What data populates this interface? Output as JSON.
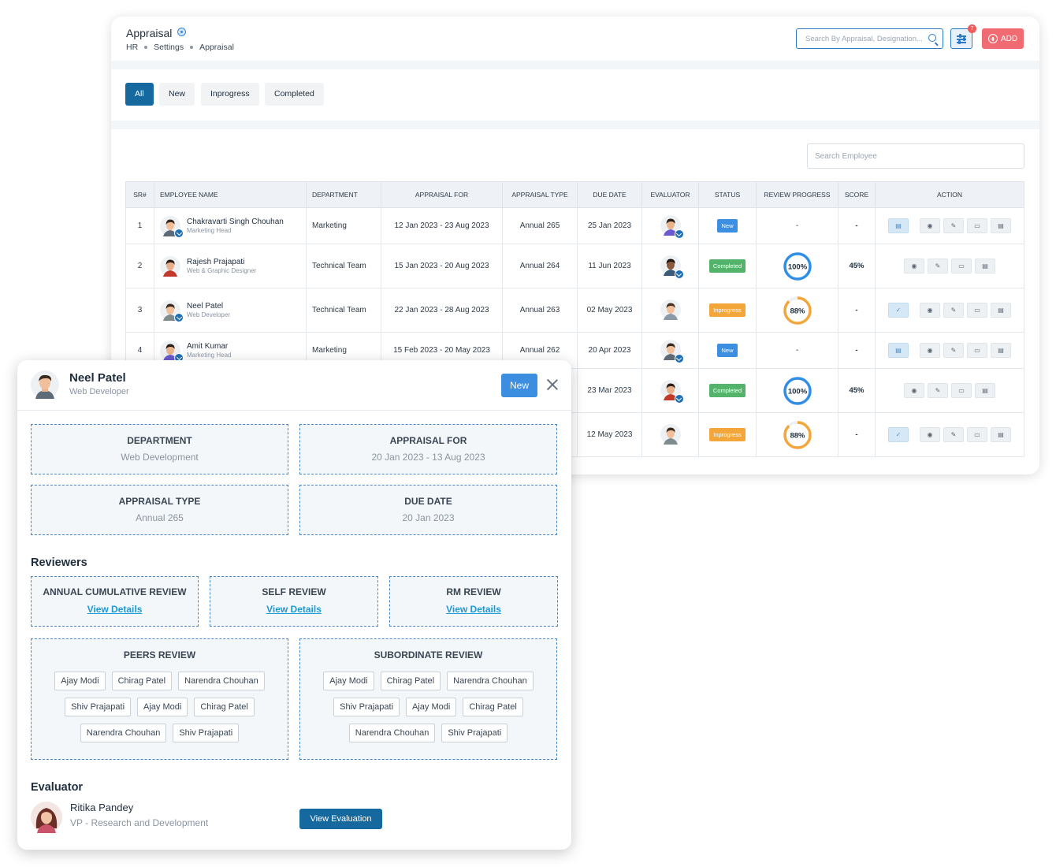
{
  "header": {
    "title": "Appraisal",
    "breadcrumb": [
      "HR",
      "Settings",
      "Appraisal"
    ],
    "search_placeholder": "Search By Appraisal, Designation...",
    "filter_count": "7",
    "add_label": "ADD"
  },
  "tabs": [
    "All",
    "New",
    "Inprogress",
    "Completed"
  ],
  "employee_search_placeholder": "Search Employee",
  "table": {
    "columns": [
      "SR#",
      "EMPLOYEE NAME",
      "DEPARTMENT",
      "APPRAISAL FOR",
      "APPRAISAL TYPE",
      "DUE DATE",
      "EVALUATOR",
      "STATUS",
      "REVIEW PROGRESS",
      "SCORE",
      "ACTION"
    ],
    "rows": [
      {
        "sr": "1",
        "name": "Chakravarti Singh Chouhan",
        "designation": "Marketing Head",
        "department": "Marketing",
        "appraisal_for": "12 Jan 2023 - 23 Aug 2023",
        "type": "Annual 265",
        "due": "25 Jan 2023",
        "status": "New",
        "progress": "-",
        "score": "-"
      },
      {
        "sr": "2",
        "name": "Rajesh Prajapati",
        "designation": "Web & Graphic Designer",
        "department": "Technical Team",
        "appraisal_for": "15 Jan 2023 - 20 Aug 2023",
        "type": "Annual 264",
        "due": "11 Jun 2023",
        "status": "Completed",
        "progress": "100%",
        "score": "45%"
      },
      {
        "sr": "3",
        "name": "Neel Patel",
        "designation": "Web Developer",
        "department": "Technical Team",
        "appraisal_for": "22 Jan 2023 - 28 Aug 2023",
        "type": "Annual 263",
        "due": "02 May 2023",
        "status": "Inprogress",
        "progress": "88%",
        "score": "-"
      },
      {
        "sr": "4",
        "name": "Amit Kumar",
        "designation": "Marketing Head",
        "department": "Marketing",
        "appraisal_for": "15 Feb 2023 - 20 May 2023",
        "type": "Annual 262",
        "due": "20 Apr 2023",
        "status": "New",
        "progress": "-",
        "score": "-"
      },
      {
        "sr": "",
        "name": "",
        "designation": "",
        "department": "",
        "appraisal_for": "",
        "type": "",
        "due": "23 Mar 2023",
        "status": "Completed",
        "progress": "100%",
        "score": "45%"
      },
      {
        "sr": "",
        "name": "",
        "designation": "",
        "department": "",
        "appraisal_for": "",
        "type": "",
        "due": "12 May 2023",
        "status": "Inprogress",
        "progress": "88%",
        "score": "-"
      }
    ]
  },
  "modal": {
    "name": "Neel Patel",
    "designation": "Web Developer",
    "status": "New",
    "department_label": "DEPARTMENT",
    "department": "Web Development",
    "appraisal_for_label": "APPRAISAL FOR",
    "appraisal_for": "20 Jan 2023 - 13 Aug 2023",
    "appraisal_type_label": "APPRAISAL TYPE",
    "appraisal_type": "Annual 265",
    "due_date_label": "DUE DATE",
    "due_date": "20 Jan 2023",
    "reviewers_title": "Reviewers",
    "reviews": [
      {
        "label": "ANNUAL CUMULATIVE REVIEW",
        "link": "View Details"
      },
      {
        "label": "SELF REVIEW",
        "link": "View Details"
      },
      {
        "label": "RM REVIEW",
        "link": "View Details"
      }
    ],
    "peers_label": "PEERS REVIEW",
    "peers": [
      "Ajay Modi",
      "Chirag Patel",
      "Narendra Chouhan",
      "Shiv Prajapati",
      "Ajay Modi",
      "Chirag Patel",
      "Narendra Chouhan",
      "Shiv Prajapati"
    ],
    "subordinates_label": "SUBORDINATE REVIEW",
    "subordinates": [
      "Ajay Modi",
      "Chirag Patel",
      "Narendra Chouhan",
      "Shiv Prajapati",
      "Ajay Modi",
      "Chirag Patel",
      "Narendra Chouhan",
      "Shiv Prajapati"
    ],
    "evaluator_title": "Evaluator",
    "evaluator_name": "Ritika Pandey",
    "evaluator_role": "VP - Research and Development",
    "view_evaluation_label": "View Evaluation"
  },
  "colors": {
    "primary": "#16699e",
    "accent_blue": "#3c8ee0",
    "completed": "#53b36a",
    "inprogress": "#f3a73b",
    "add": "#f16c72",
    "link": "#1a9ad6"
  }
}
